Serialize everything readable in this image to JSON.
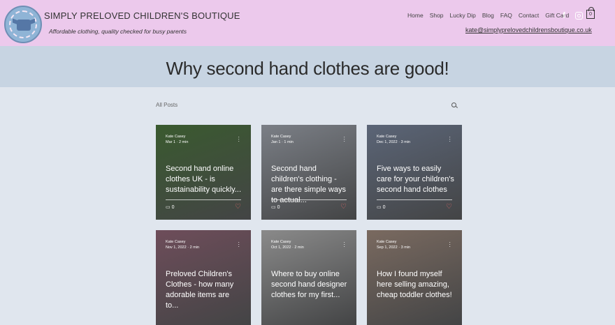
{
  "header": {
    "brand": "SIMPLY PRELOVED CHILDREN'S BOUTIQUE",
    "tagline": "Affordable clothing, quality checked for busy parents",
    "nav": [
      "Home",
      "Shop",
      "Lucky Dip",
      "Blog",
      "FAQ",
      "Contact",
      "Gift Card"
    ],
    "email": "kate@simplyprelovedchildrensboutique.co.uk",
    "cart_count": "0"
  },
  "hero": {
    "title": "Why second hand clothes are good!"
  },
  "blog": {
    "filter_label": "All Posts",
    "posts": [
      {
        "author": "Kate Casey",
        "date": "Mar 1",
        "read": "2 min",
        "title": "Second hand online clothes UK - is sustainability quickly...",
        "comments": "0",
        "color": "#3a5a2f"
      },
      {
        "author": "Kate Casey",
        "date": "Jan 1",
        "read": "1 min",
        "title": "Second hand children's clothing - are there simple ways to actual...",
        "comments": "0",
        "color": "#7b7f86"
      },
      {
        "author": "Kate Casey",
        "date": "Dec 1, 2022",
        "read": "3 min",
        "title": "Five ways to easily care for your children's second hand clothes",
        "comments": "0",
        "color": "#5b6577"
      },
      {
        "author": "Kate Casey",
        "date": "Nov 1, 2022",
        "read": "2 min",
        "title": "Preloved Children's Clothes - how many adorable items are to...",
        "comments": "",
        "color": "#6e4d5a"
      },
      {
        "author": "Kate Casey",
        "date": "Oct 1, 2022",
        "read": "2 min",
        "title": "Where to buy online second hand designer clothes for my first...",
        "comments": "",
        "color": "#8a8a8a"
      },
      {
        "author": "Kate Casey",
        "date": "Sep 1, 2022",
        "read": "3 min",
        "title": "How I found myself here selling amazing, cheap toddler clothes!",
        "comments": "",
        "color": "#7a6a60"
      }
    ]
  },
  "colors": {
    "header_bg": "#ecc9ec",
    "hero_bg": "#c7d4e2",
    "page_bg": "#e0e6ee",
    "heart": "#e46a6a"
  }
}
